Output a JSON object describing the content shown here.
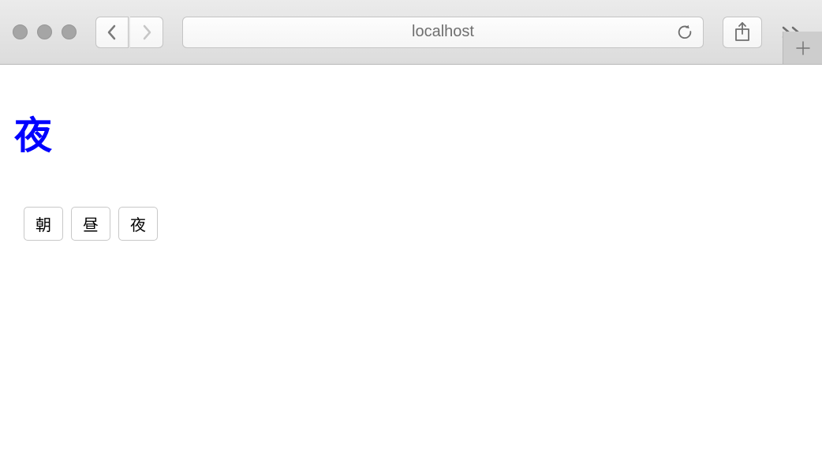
{
  "browser": {
    "url": "localhost"
  },
  "page": {
    "heading": "夜",
    "buttons": [
      {
        "label": "朝"
      },
      {
        "label": "昼"
      },
      {
        "label": "夜"
      }
    ]
  }
}
